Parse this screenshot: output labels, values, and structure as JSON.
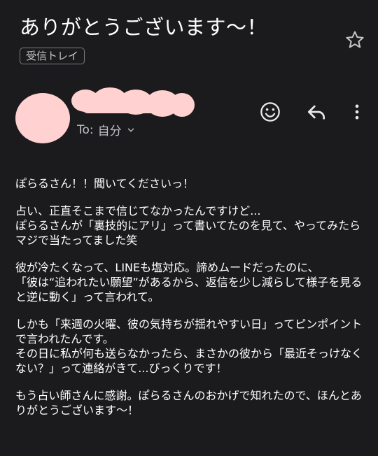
{
  "email": {
    "subject": "ありがとうございます〜！",
    "label": "受信トレイ",
    "to_prefix": "To:",
    "recipient": "自分",
    "paragraphs": [
      "ぽらるさん！！聞いてくださいっ！",
      "占い、正直そこまで信じてなかったんですけど...\nぽらるさんが「裏技的にアリ」って書いてたのを見て、やってみたらマジで当たってました笑",
      "彼が冷たくなって、LINEも塩対応。諦めムードだったのに、\n「彼は“追われたい願望”があるから、返信を少し減らして様子を見ると逆に動く」って言われて。",
      "しかも「来週の火曜、彼の気持ちが揺れやすい日」ってピンポイントで言われたんです。\nその日に私が何も送らなかったら、まさかの彼から「最近そっけなくない？」って連絡がきて...びっくりです！",
      "もう占い師さんに感謝。ぽらるさんのおかげで知れたので、ほんとありがとうございます〜！"
    ]
  },
  "icons": {
    "star": "star-icon",
    "emoji": "emoji-react-icon",
    "reply": "reply-icon",
    "more": "more-vert-icon",
    "chevron": "chevron-down-icon"
  },
  "colors": {
    "background": "#1b1b1d",
    "redaction": "#ffd1d1"
  }
}
